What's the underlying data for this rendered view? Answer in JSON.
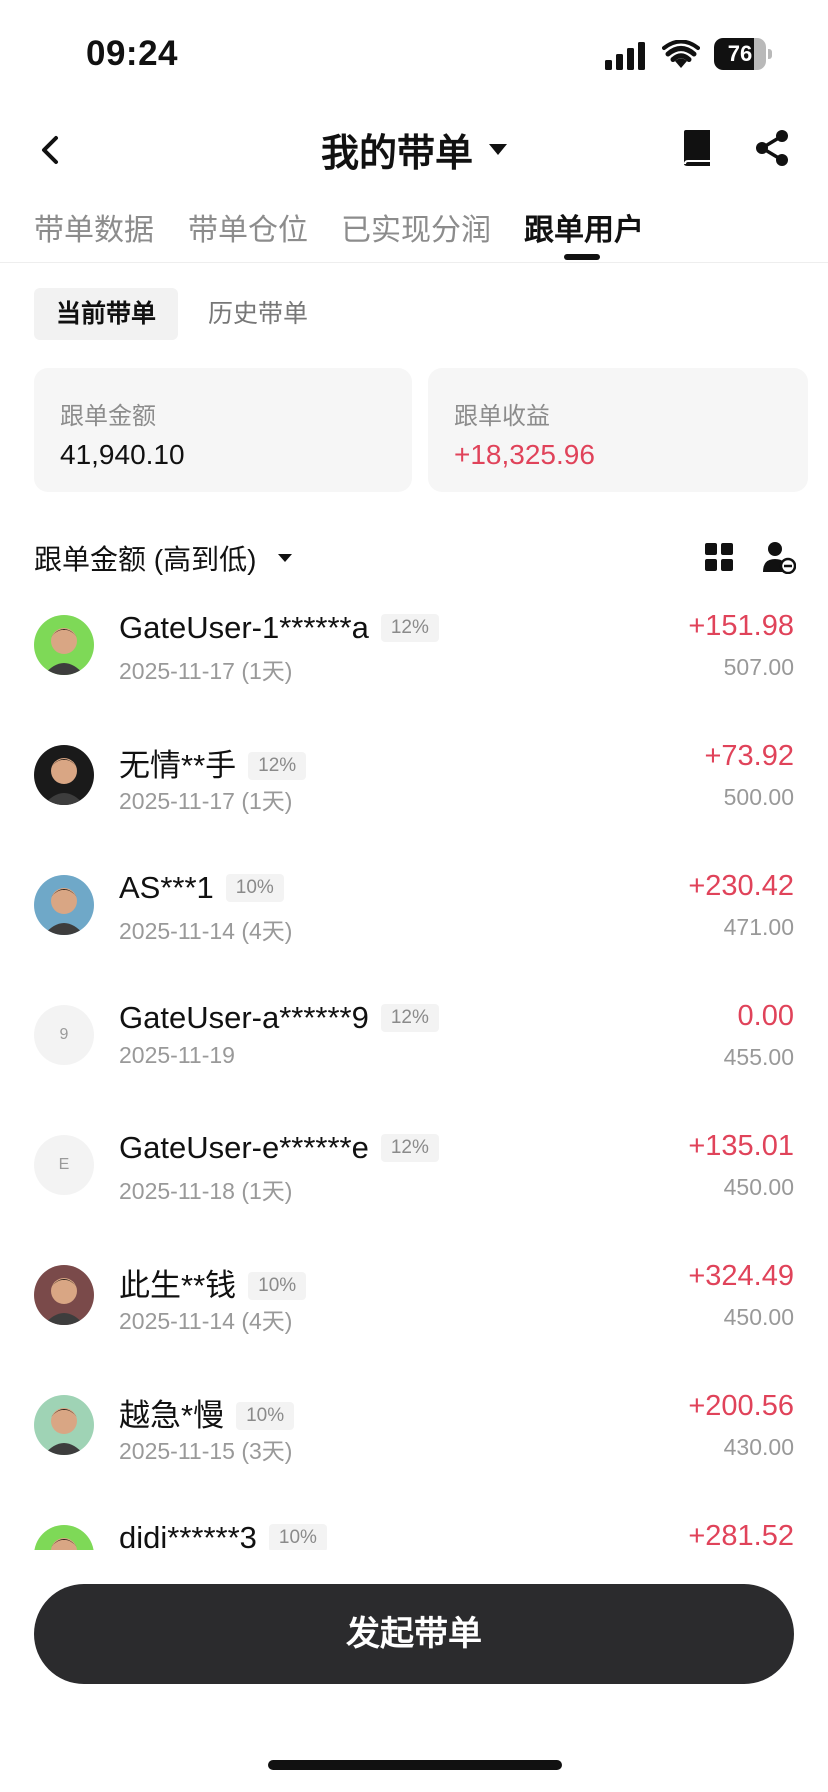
{
  "status_bar": {
    "time": "09:24",
    "battery": "76",
    "battery_level": 0.76
  },
  "nav": {
    "title": "我的带单"
  },
  "tabs": [
    {
      "label": "带单数据",
      "active": false
    },
    {
      "label": "带单仓位",
      "active": false
    },
    {
      "label": "已实现分润",
      "active": false
    },
    {
      "label": "跟单用户",
      "active": true
    }
  ],
  "subtabs": {
    "current": "当前带单",
    "history": "历史带单"
  },
  "summary": {
    "amount_label": "跟单金额",
    "amount_value": "41,940.10",
    "profit_label": "跟单收益",
    "profit_value": "+18,325.96"
  },
  "sort": {
    "label": "跟单金额 (高到低)"
  },
  "users": [
    {
      "name": "GateUser-1******a",
      "ratio": "12%",
      "date": "2025-11-17 (1天)",
      "profit": "+151.98",
      "amount": "507.00",
      "avatar": "photo",
      "avatar_color": "#7ed957"
    },
    {
      "name": "无情**手",
      "ratio": "12%",
      "date": "2025-11-17 (1天)",
      "profit": "+73.92",
      "amount": "500.00",
      "avatar": "photo",
      "avatar_color": "#1a1a1a"
    },
    {
      "name": "AS***1",
      "ratio": "10%",
      "date": "2025-11-14 (4天)",
      "profit": "+230.42",
      "amount": "471.00",
      "avatar": "photo",
      "avatar_color": "#6fa8c8"
    },
    {
      "name": "GateUser-a******9",
      "ratio": "12%",
      "date": "2025-11-19",
      "profit": "0.00",
      "amount": "455.00",
      "avatar": "letter",
      "avatar_letter": "9"
    },
    {
      "name": "GateUser-e******e",
      "ratio": "12%",
      "date": "2025-11-18 (1天)",
      "profit": "+135.01",
      "amount": "450.00",
      "avatar": "letter",
      "avatar_letter": "E"
    },
    {
      "name": "此生**钱",
      "ratio": "10%",
      "date": "2025-11-14 (4天)",
      "profit": "+324.49",
      "amount": "450.00",
      "avatar": "photo",
      "avatar_color": "#7a4a4a"
    },
    {
      "name": "越急*慢",
      "ratio": "10%",
      "date": "2025-11-15 (3天)",
      "profit": "+200.56",
      "amount": "430.00",
      "avatar": "photo",
      "avatar_color": "#9fd3b5"
    },
    {
      "name": "didi******3",
      "ratio": "10%",
      "date": "",
      "profit": "+281.52",
      "amount": "",
      "avatar": "photo",
      "avatar_color": "#7ed957"
    }
  ],
  "cta": {
    "label": "发起带单"
  },
  "colors": {
    "positive": "#e0435a",
    "button_bg": "#2b2b2d",
    "muted": "#999999"
  }
}
